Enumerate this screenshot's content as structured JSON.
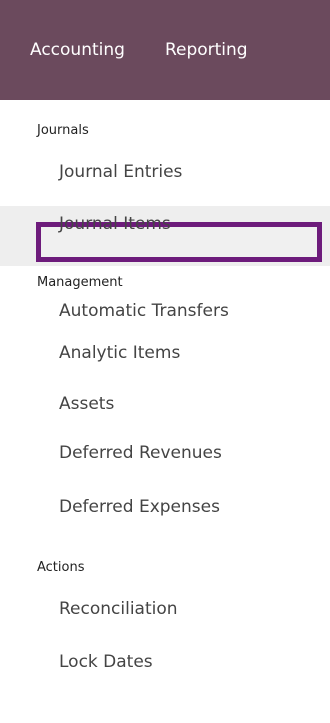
{
  "topbar": {
    "items": [
      {
        "label": "Accounting"
      },
      {
        "label": "Reporting"
      }
    ]
  },
  "menu": {
    "sections": [
      {
        "header": "Journals",
        "items": [
          "Journal Entries",
          "Journal Items"
        ]
      },
      {
        "header": "Management",
        "items": [
          "Automatic Transfers",
          "Analytic Items",
          "Assets",
          "Deferred Revenues",
          "Deferred Expenses"
        ]
      },
      {
        "header": "Actions",
        "items": [
          "Reconciliation",
          "Lock Dates"
        ]
      }
    ],
    "active_item": "Automatic Transfers"
  },
  "colors": {
    "topbar_bg": "#6b4a5d",
    "highlight_border": "#6d1b7b",
    "active_row_bg": "#eeeeee"
  }
}
